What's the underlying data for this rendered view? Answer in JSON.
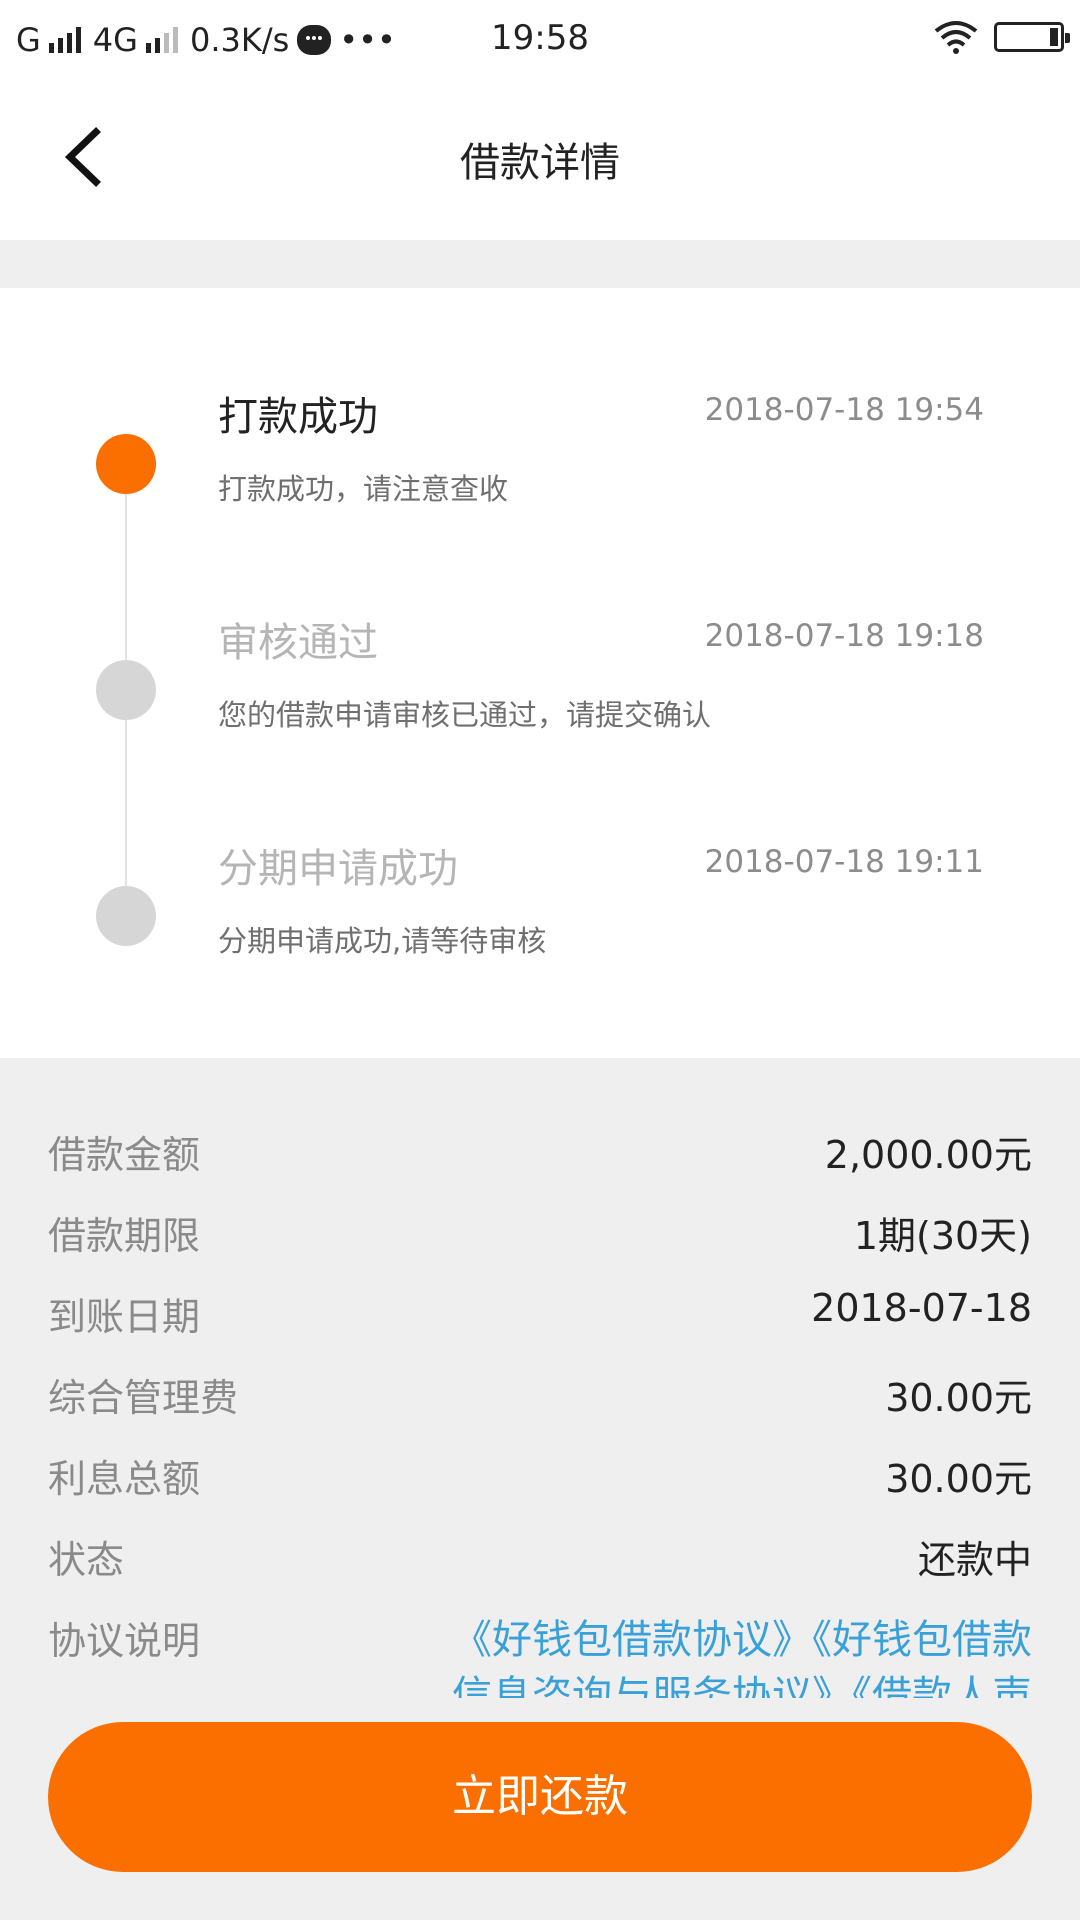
{
  "status_bar": {
    "carrier1": "G",
    "carrier2": "4G",
    "speed": "0.3K/s",
    "more": "•••",
    "time": "19:58",
    "icons": [
      "signal-icon",
      "chat-icon",
      "wifi-icon",
      "battery-icon"
    ]
  },
  "header": {
    "title": "借款详情",
    "back_icon": "chevron-left-icon"
  },
  "timeline": [
    {
      "title": "打款成功",
      "time": "2018-07-18 19:54",
      "desc": "打款成功，请注意查收",
      "active": true
    },
    {
      "title": "审核通过",
      "time": "2018-07-18 19:18",
      "desc": "您的借款申请审核已通过，请提交确认",
      "active": false
    },
    {
      "title": "分期申请成功",
      "time": "2018-07-18 19:11",
      "desc": "分期申请成功,请等待审核",
      "active": false
    }
  ],
  "details": [
    {
      "label": "借款金额",
      "value": "2,000.00元"
    },
    {
      "label": "借款期限",
      "value": "1期(30天)"
    },
    {
      "label": "到账日期",
      "value": "2018-07-18"
    },
    {
      "label": "综合管理费",
      "value": "30.00元"
    },
    {
      "label": "利息总额",
      "value": "30.00元"
    },
    {
      "label": "状态",
      "value": "还款中"
    }
  ],
  "agreement": {
    "label": "协议说明",
    "line1": "《好钱包借款协议》《好钱包借款",
    "line2": "信息咨询与服务协议》《借款人声"
  },
  "action": {
    "repay_label": "立即还款"
  },
  "colors": {
    "accent": "#fa6f00",
    "link": "#3aa0d8",
    "inactive_dot": "#d6d6d6",
    "inactive_title": "#b5b5b5",
    "background_band": "#efefef"
  }
}
